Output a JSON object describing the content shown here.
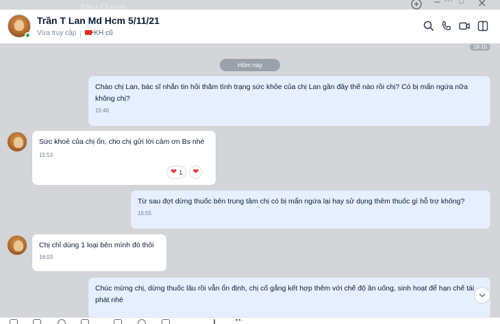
{
  "window": {
    "ghost_title": "Như Quỳnh",
    "minimize": "–",
    "more": "···",
    "maximize": "□",
    "close": "✕"
  },
  "header": {
    "contact_name": "Trần T Lan Md Hcm 5/11/21",
    "presence": "Vừa truy cập",
    "tag_label": "KH cũ",
    "icons": [
      "search-icon",
      "phone-icon",
      "video-call-icon",
      "sidebar-toggle-icon"
    ]
  },
  "chat": {
    "top_time": "18:15",
    "day_label": "Hôm nay",
    "messages": [
      {
        "sender": "me",
        "text": "Chào chị Lan, bác sĩ nhắn tin hỏi thăm tình trạng sức khỏe của chị Lan gần đây thế nào rồi chị? Có bị mẩn ngứa nữa không chị?",
        "time": "15:46"
      },
      {
        "sender": "them",
        "text": "Sức khoẻ của chị ổn, cho chị gửi lời cảm ơn Bs nhé",
        "time": "15:53",
        "reaction_count": "1"
      },
      {
        "sender": "me",
        "text": "Từ sau đợt dừng thuốc bên trung tâm chị có bị mẩn ngứa lại hay sử dụng thêm thuốc gì hỗ trợ không?",
        "time": "15:55"
      },
      {
        "sender": "them",
        "text": "Chị chỉ dùng 1 loại bên mình đó thôi",
        "time": "16:03"
      },
      {
        "sender": "me",
        "text": "Chúc mừng chị, dừng thuốc lâu rồi vẫn ổn định, chị cố gắng kết hợp thêm với chế độ ăn uống, sinh hoạt để hạn chế tái phát nhé",
        "time": ""
      }
    ]
  },
  "colors": {
    "my_bubble": "#e5efff",
    "their_bubble": "#ffffff",
    "chat_bg": "#d3d5d8",
    "online": "#30a14e",
    "tag": "#e0311f",
    "heart": "#e53946"
  }
}
